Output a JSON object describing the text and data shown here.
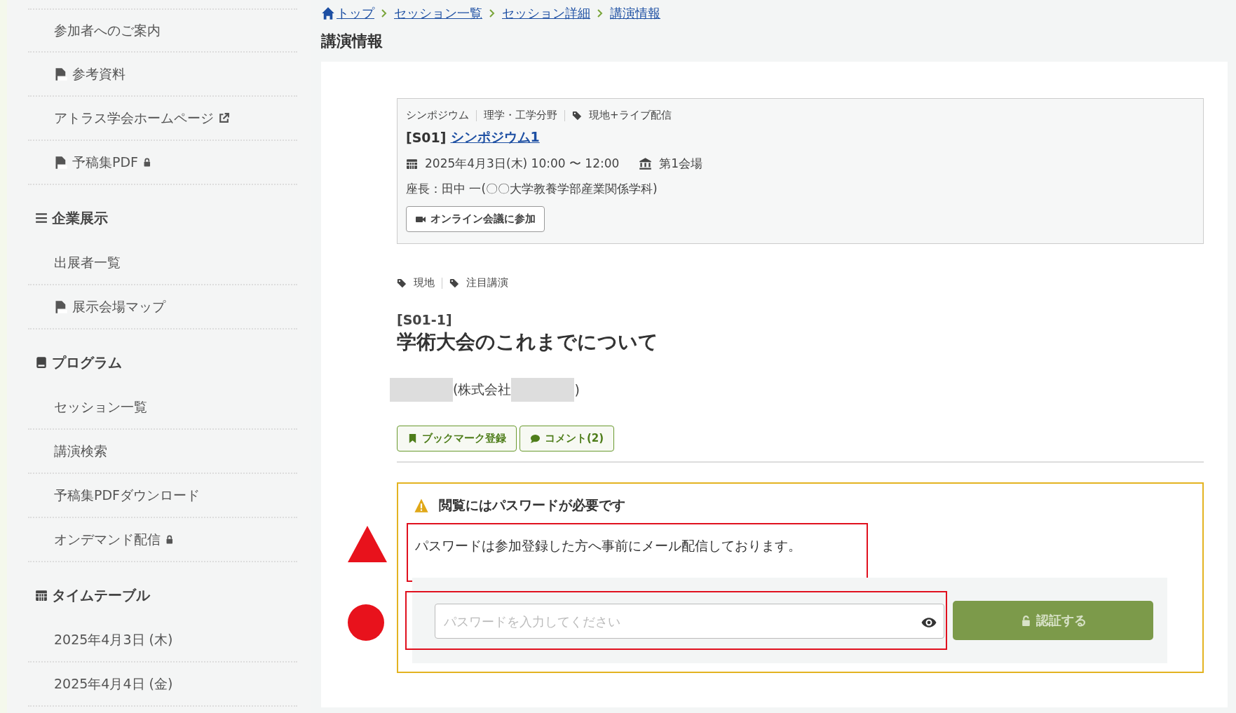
{
  "sidebar": {
    "sections": [
      {
        "items": [
          {
            "label": "参加者へのご案内",
            "kind": "plain"
          },
          {
            "label": "参考資料",
            "kind": "pdf"
          },
          {
            "label": "アトラス学会ホームページ",
            "kind": "external"
          },
          {
            "label": "予稿集PDF",
            "kind": "pdf_locked"
          }
        ]
      },
      {
        "heading": "企業展示",
        "kind": "list",
        "items": [
          {
            "label": "出展者一覧",
            "kind": "plain"
          },
          {
            "label": "展示会場マップ",
            "kind": "pdf"
          }
        ]
      },
      {
        "heading": "プログラム",
        "kind": "book",
        "items": [
          {
            "label": "セッション一覧",
            "kind": "plain"
          },
          {
            "label": "講演検索",
            "kind": "plain"
          },
          {
            "label": "予稿集PDFダウンロード",
            "kind": "plain"
          },
          {
            "label": "オンデマンド配信",
            "kind": "locked"
          }
        ]
      },
      {
        "heading": "タイムテーブル",
        "kind": "calendar",
        "items": [
          {
            "label": "2025年4月3日 (木)",
            "kind": "plain"
          },
          {
            "label": "2025年4月4日 (金)",
            "kind": "plain"
          }
        ]
      }
    ]
  },
  "breadcrumb": [
    {
      "label": "トップ"
    },
    {
      "label": "セッション一覧"
    },
    {
      "label": "セッション詳細"
    },
    {
      "label": "講演情報"
    }
  ],
  "page_title": "講演情報",
  "session": {
    "categories": [
      {
        "label": "シンポジウム",
        "kind": "plain"
      },
      {
        "label": "理学・工学分野",
        "kind": "plain"
      },
      {
        "label": "現地+ライブ配信",
        "kind": "tag"
      }
    ],
    "code": "[S01]",
    "title": "シンポジウム1",
    "datetime": "2025年4月3日(木) 10:00 〜 12:00",
    "venue": "第1会場",
    "chair": "座長：田中 一(〇〇大学教養学部産業関係学科)",
    "join_button": "オンライン会議に参加"
  },
  "talk": {
    "tags": [
      "現地",
      "注目講演"
    ],
    "code": "[S01-1]",
    "title": "学術大会のこれまでについて",
    "author": [
      {
        "kind": "redacted"
      },
      {
        "kind": "text",
        "text": "(株式会社"
      },
      {
        "kind": "redacted"
      },
      {
        "kind": "text",
        "text": ")"
      }
    ],
    "buttons": [
      {
        "label": "ブックマーク登録"
      },
      {
        "label": "コメント(2)"
      }
    ]
  },
  "password_box": {
    "heading": "閲覧にはパスワードが必要です",
    "message": "パスワードは参加登録した方へ事前にメール配信しております。",
    "message_highlighted": true,
    "placeholder": "パスワードを入力してください",
    "field_highlighted": true,
    "submit": {
      "label": "認証する",
      "disabled": true
    }
  },
  "annotation_marks": [
    {
      "kind": "triangle"
    },
    {
      "kind": "circle"
    }
  ]
}
